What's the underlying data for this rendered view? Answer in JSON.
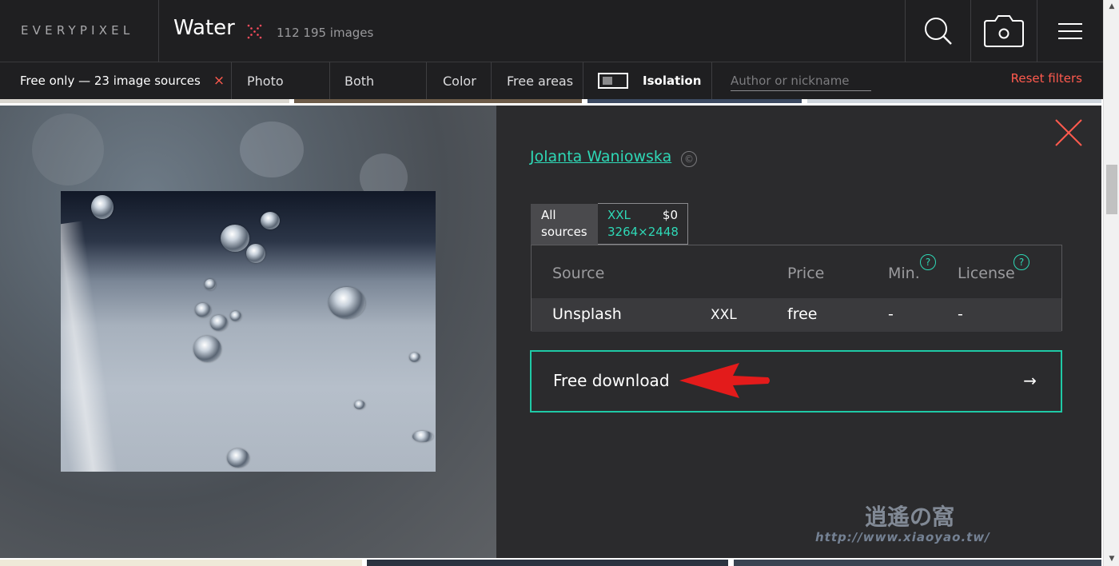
{
  "header": {
    "logo": "EVERYPIXEL",
    "query": "Water",
    "count": "112 195 images",
    "search_icon": "search-icon",
    "camera_icon": "camera-icon",
    "menu_icon": "hamburger-menu-icon"
  },
  "filters": {
    "free_only": "Free only — 23 image sources",
    "free_close": "×",
    "photo": "Photo",
    "both": "Both",
    "color": "Color",
    "free_areas": "Free areas",
    "isolation": "Isolation",
    "isolation_enabled": false,
    "author_placeholder": "Author or nickname",
    "reset": "Reset filters"
  },
  "detail": {
    "author": "Jolanta Waniowska",
    "copyright_symbol": "©",
    "tabs": {
      "all_line1": "All",
      "all_line2": "sources",
      "size": "XXL",
      "price": "$0",
      "dimensions": "3264×2448"
    },
    "table": {
      "headers": {
        "source": "Source",
        "price": "Price",
        "min": "Min.",
        "license": "License"
      },
      "help_glyph": "?",
      "rows": [
        {
          "source": "Unsplash",
          "size": "XXL",
          "price": "free",
          "min": "-",
          "license": "-"
        }
      ]
    },
    "download_label": "Free download",
    "download_arrow": "→"
  },
  "watermark": {
    "logo": "逍遙の窩",
    "url": "http://www.xiaoyao.tw/"
  },
  "colors": {
    "accent_teal": "#2ed8b6",
    "reset_red": "#ff5a4e",
    "header_bg": "#1f1f21",
    "panel_bg": "#2b2b2d"
  }
}
